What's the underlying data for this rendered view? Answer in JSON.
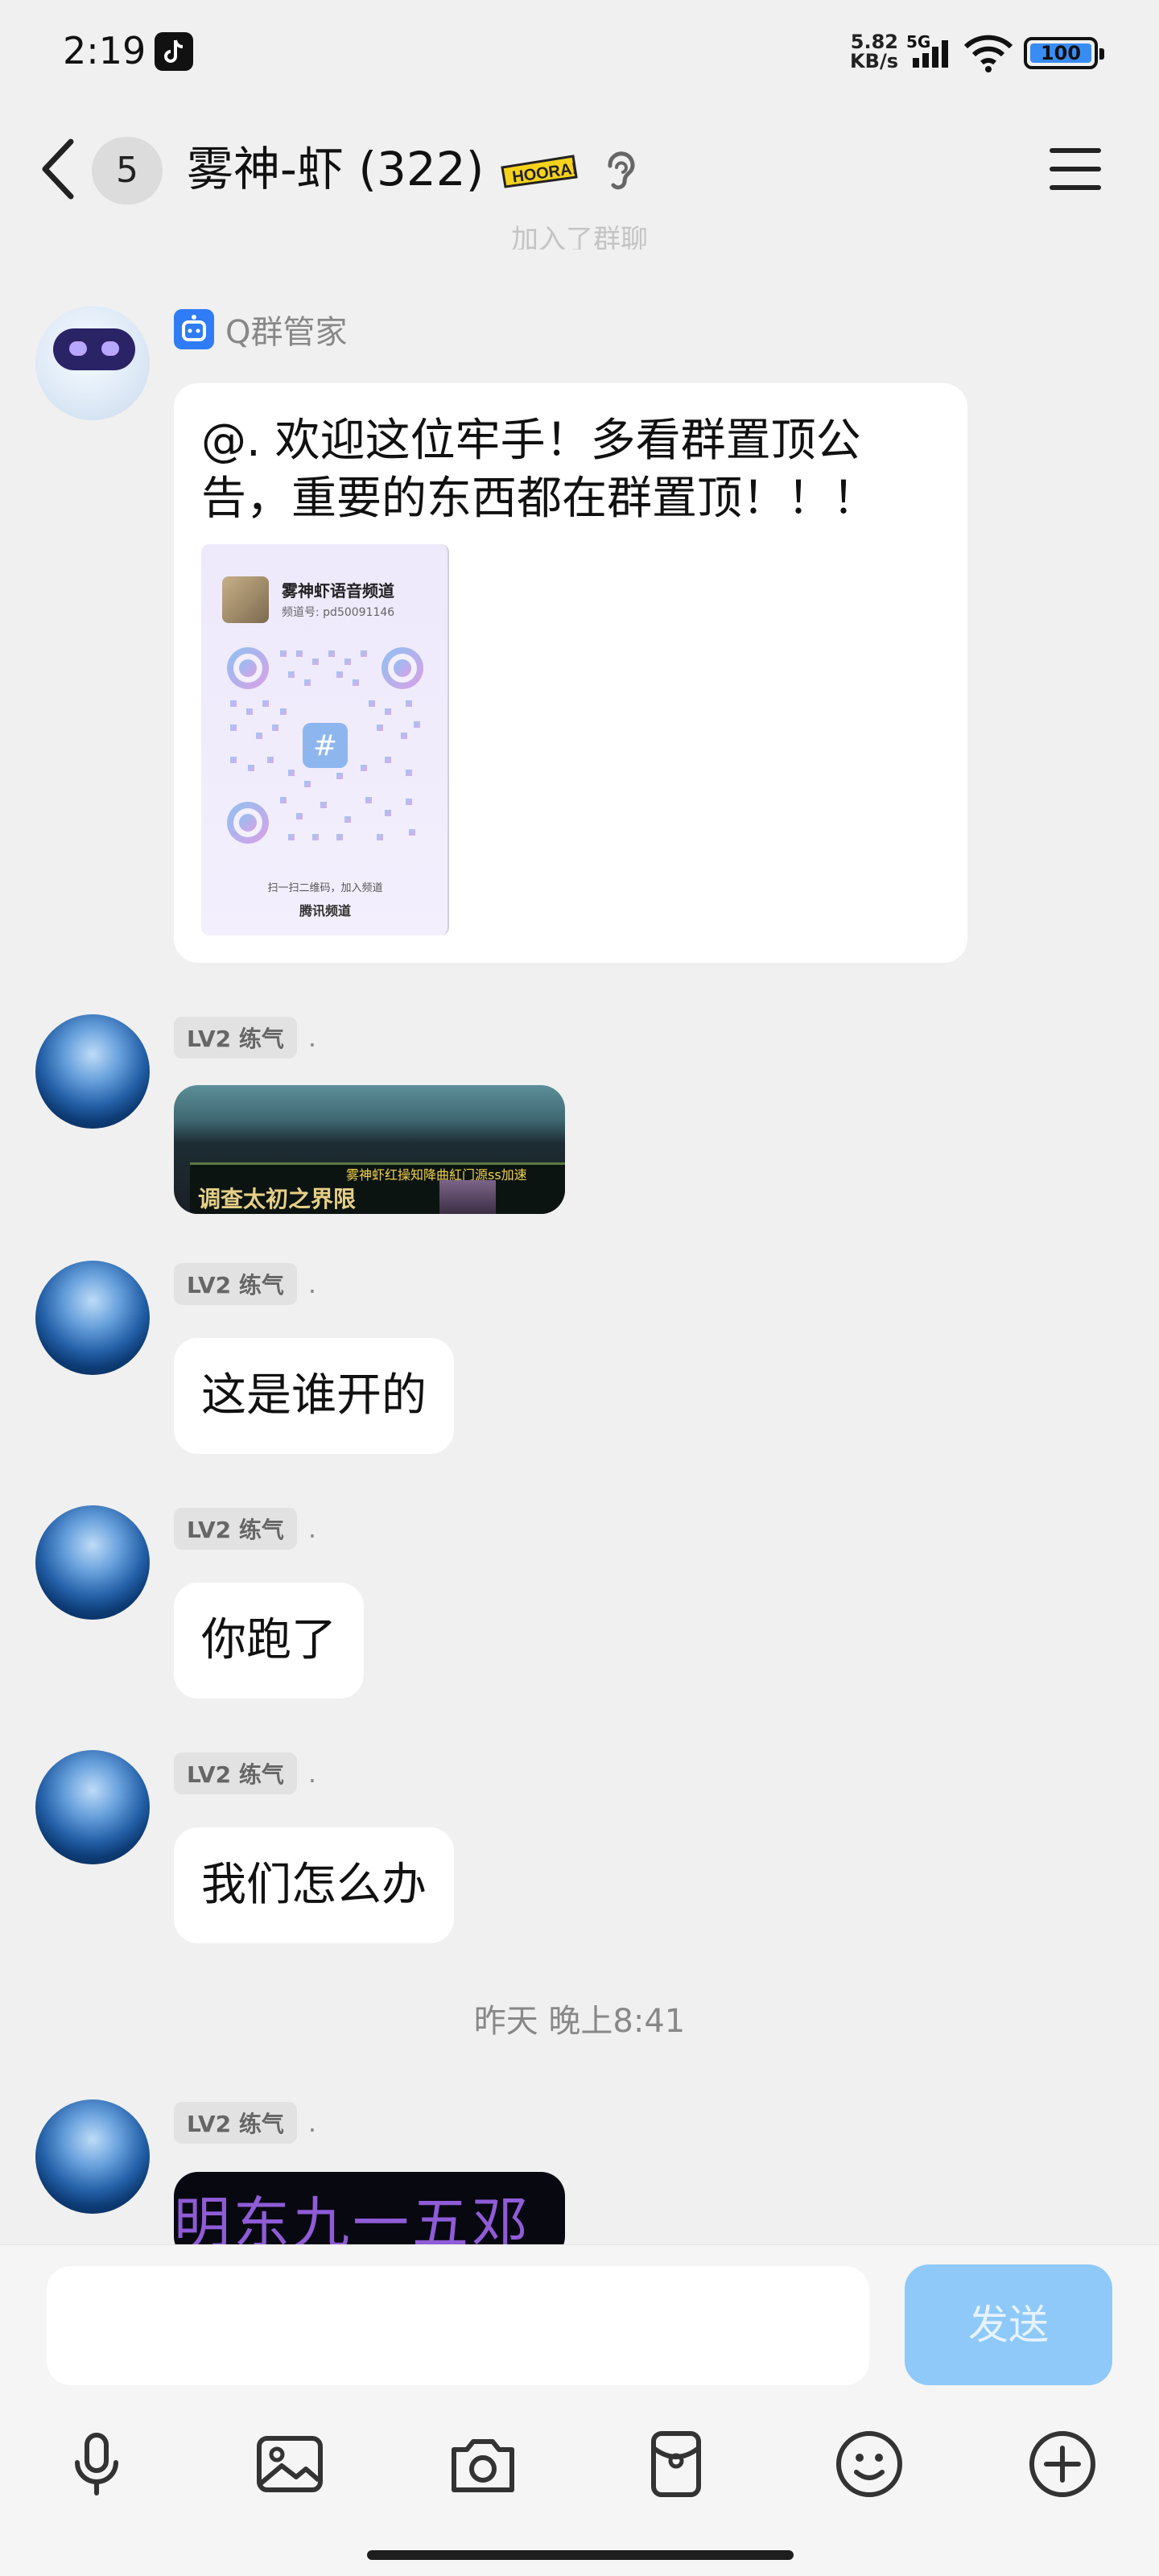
{
  "status_bar": {
    "time": "2:19",
    "speed_value": "5.82",
    "speed_unit": "KB/s",
    "network": "5G",
    "battery": "100"
  },
  "header": {
    "unread_count": "5",
    "title": "雾神-虾 (322)",
    "badge_text": "HOORA!"
  },
  "faded_note": "加入了群聊",
  "messages": [
    {
      "sender": "Q群管家",
      "text": "@. 欢迎这位牢手！多看群置顶公告，重要的东西都在群置顶！！！",
      "qr_card": {
        "title": "雾神虾语音频道",
        "channel_id": "频道号: pd50091146",
        "caption": "扫一扫二维码，加入频道",
        "brand": "腾讯频道"
      }
    },
    {
      "level": "LV2 练气",
      "name": ".",
      "image_text": "调查太初之界限",
      "image_caption": "雾神虾红操知降曲紅门源ss加速"
    },
    {
      "level": "LV2 练气",
      "name": ".",
      "text": "这是谁开的"
    },
    {
      "level": "LV2 练气",
      "name": ".",
      "text": "你跑了"
    },
    {
      "level": "LV2 练气",
      "name": ".",
      "text": "我们怎么办"
    },
    {
      "level": "LV2 练气",
      "name": ".",
      "image_text": "明东九一五邓"
    }
  ],
  "timestamp": "昨天 晚上8:41",
  "input": {
    "placeholder": "",
    "send_label": "发送"
  },
  "colors": {
    "accent": "#2f7cf6",
    "send_disabled": "#8ec9f9",
    "background": "#f0f0f0"
  }
}
